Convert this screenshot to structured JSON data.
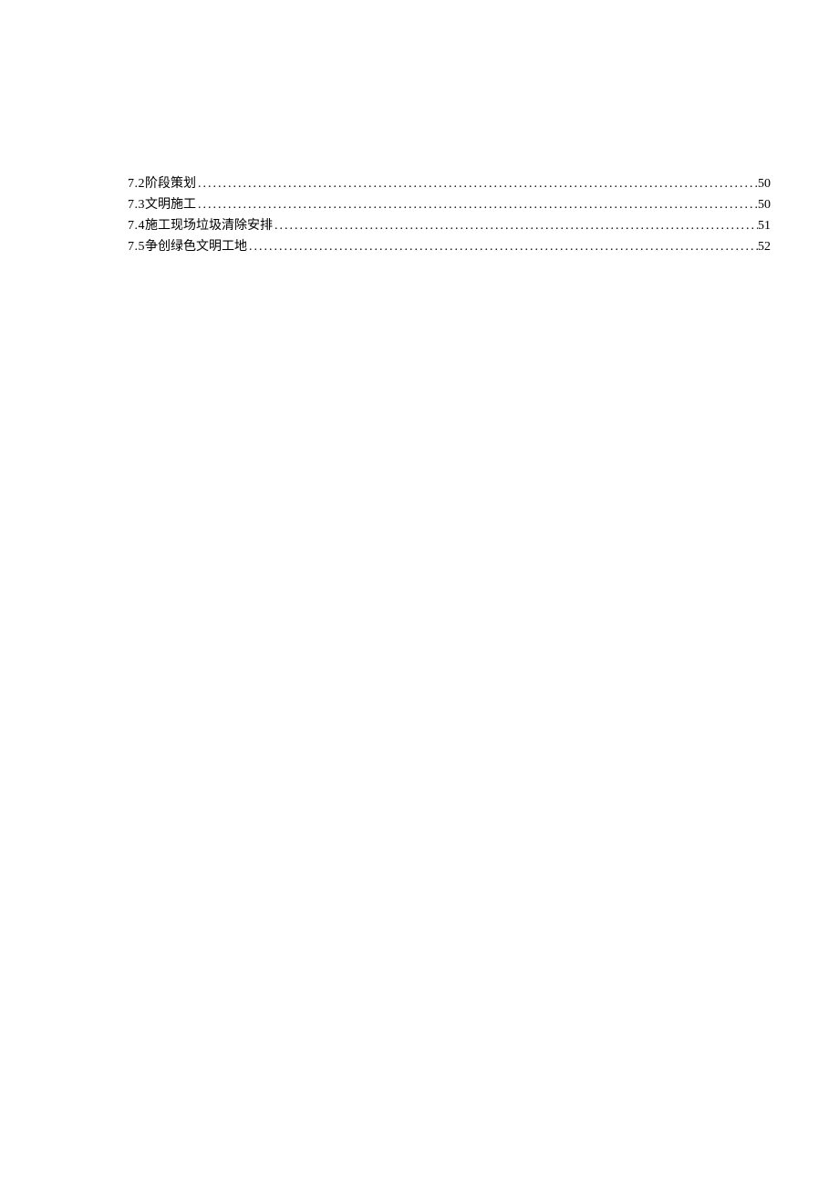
{
  "toc": {
    "entries": [
      {
        "number": "7.2",
        "title": "阶段策划",
        "page": "50"
      },
      {
        "number": "7.3",
        "title": "文明施工",
        "page": "50"
      },
      {
        "number": "7.4",
        "title": "施工现场垃圾清除安排",
        "page": "51"
      },
      {
        "number": "7.5",
        "title": "争创绿色文明工地",
        "page": "52"
      }
    ]
  }
}
